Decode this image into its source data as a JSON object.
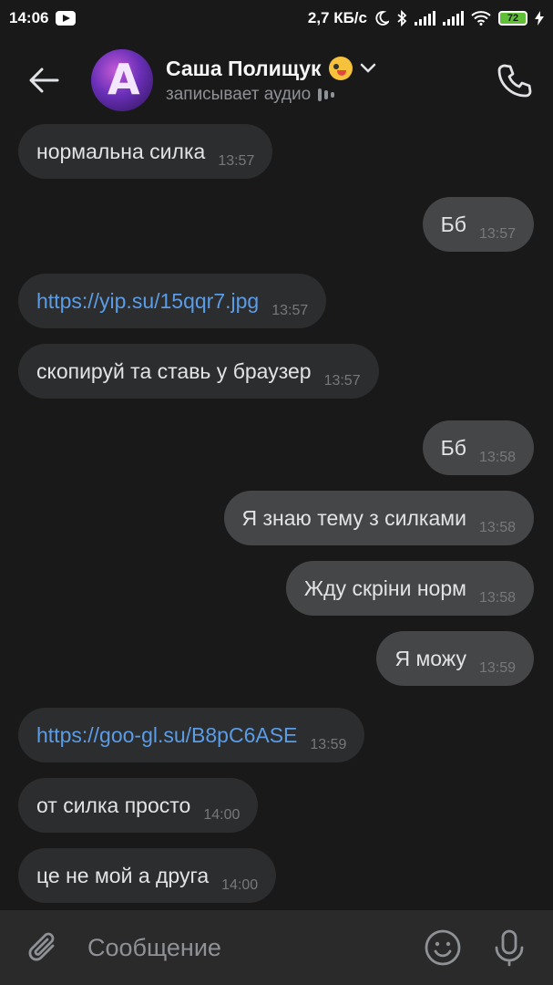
{
  "status_bar": {
    "time": "14:06",
    "speed": "2,7 КБ/с",
    "battery": "72",
    "icons": [
      "youtube-icon",
      "moon-icon",
      "bluetooth-icon",
      "signal-icon",
      "signal-icon",
      "wifi-icon",
      "battery-icon",
      "charging-icon"
    ]
  },
  "header": {
    "contact_name": "Саша Полищук",
    "status": "записывает аудио"
  },
  "messages": [
    {
      "dir": "in",
      "text": "нормальна силка",
      "time": "13:57"
    },
    {
      "dir": "out",
      "text": "Бб",
      "time": "13:57"
    },
    {
      "dir": "in",
      "text": "https://yip.su/15qqr7.jpg",
      "time": "13:57",
      "link": true
    },
    {
      "dir": "in",
      "text": "скопируй та ставь у браузер",
      "time": "13:57"
    },
    {
      "dir": "out",
      "text": "Бб",
      "time": "13:58"
    },
    {
      "dir": "out",
      "text": "Я знаю тему з силками",
      "time": "13:58"
    },
    {
      "dir": "out",
      "text": "Жду скріни норм",
      "time": "13:58"
    },
    {
      "dir": "out",
      "text": "Я можу",
      "time": "13:59"
    },
    {
      "dir": "in",
      "text": "https://goo-gl.su/B8pC6ASE",
      "time": "13:59",
      "link": true
    },
    {
      "dir": "in",
      "text": "от силка просто",
      "time": "14:00"
    },
    {
      "dir": "in",
      "text": "це не мой а друга",
      "time": "14:00"
    }
  ],
  "composer": {
    "placeholder": "Сообщение"
  },
  "colors": {
    "background": "#19191a",
    "incoming_bubble": "#2c2d2e",
    "outgoing_bubble": "#454647",
    "link": "#5b9ce6",
    "battery": "#5fbf36"
  }
}
